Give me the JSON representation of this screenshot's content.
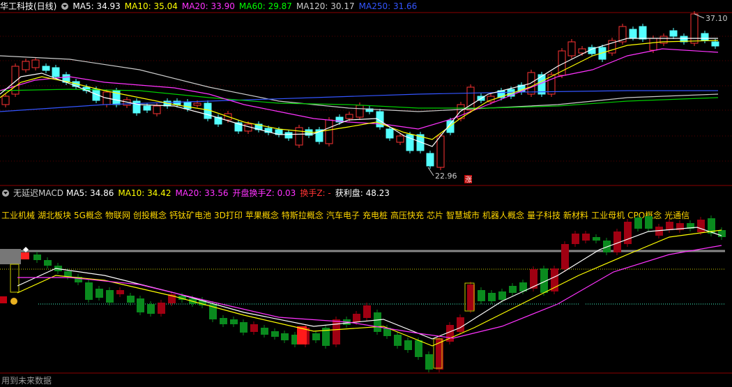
{
  "top": {
    "stock_name": "华工科技(日线)",
    "ma": [
      {
        "label": "MA5: 34.93",
        "color": "#ffffff"
      },
      {
        "label": "MA10: 35.04",
        "color": "#ffff00"
      },
      {
        "label": "MA20: 33.90",
        "color": "#ff33ff"
      },
      {
        "label": "MA60: 29.87",
        "color": "#00ff00"
      },
      {
        "label": "MA120: 30.17",
        "color": "#cccccc"
      },
      {
        "label": "MA250: 31.66",
        "color": "#3355ff"
      }
    ],
    "high_label": "37.10",
    "low_label": "22.96",
    "zhang_label": "涨"
  },
  "mid": {
    "indicator_name": "无延迟MACD",
    "items": [
      {
        "label": "MA5: 34.86",
        "color": "#ffffff"
      },
      {
        "label": "MA10: 34.42",
        "color": "#ffff00"
      },
      {
        "label": "MA20: 33.56",
        "color": "#ff33ff"
      },
      {
        "label": "开盘换手Z: 0.03",
        "color": "#ff33ff"
      },
      {
        "label": "换手Z: -",
        "color": "#ff3333"
      },
      {
        "label": "获利盘: 48.23",
        "color": "#ffffff"
      }
    ]
  },
  "concepts": [
    "工业机械",
    "湖北板块",
    "5G概念",
    "物联网",
    "创投概念",
    "钙钛矿电池",
    "3D打印",
    "苹果概念",
    "特斯拉概念",
    "汽车电子",
    "充电桩",
    "高压快充",
    "芯片",
    "智慧城市",
    "机器人概念",
    "量子科技",
    "新材料",
    "工业母机",
    "CPO概念",
    "光通信"
  ],
  "footer": "用到未来数据",
  "colors": {
    "up": "#ff3333",
    "down": "#54ffff",
    "up2": "#c0000f",
    "down2": "#0a8a1e"
  }
}
